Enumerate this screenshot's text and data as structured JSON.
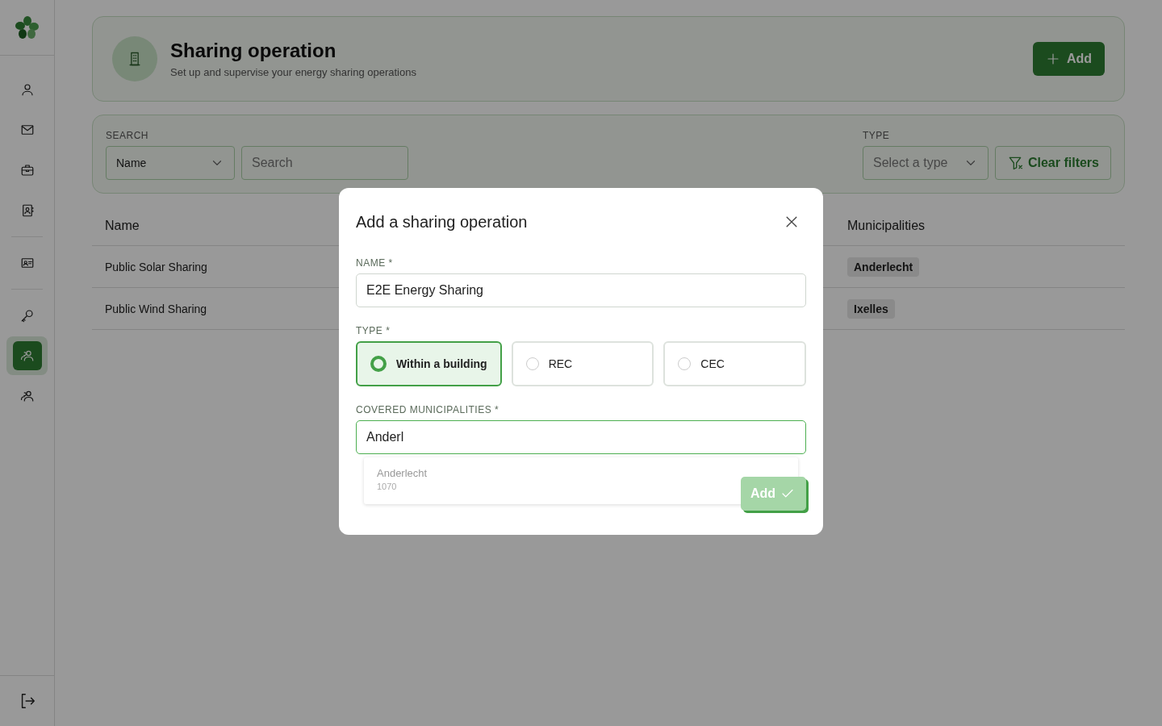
{
  "sidebar": {
    "groups": [
      {
        "items": [
          {
            "selected": false
          },
          {
            "selected": false
          },
          {
            "selected": false
          },
          {
            "selected": false
          }
        ]
      },
      {
        "items": [
          {
            "selected": false
          }
        ]
      },
      {
        "items": [
          {
            "selected": false
          },
          {
            "selected": true
          },
          {
            "selected": false
          }
        ]
      }
    ]
  },
  "header": {
    "title": "Sharing operation",
    "subtitle": "Set up and supervise your energy sharing operations",
    "add_button": "Add"
  },
  "filters": {
    "search_label": "SEARCH",
    "field_select": "Name",
    "search_placeholder": "Search",
    "type_label": "TYPE",
    "type_placeholder": "Select a type",
    "clear_button": "Clear filters"
  },
  "table": {
    "columns": [
      "Name",
      "Municipalities"
    ],
    "rows": [
      {
        "name": "Public Solar Sharing",
        "municipalities": [
          "Anderlecht"
        ]
      },
      {
        "name": "Public Wind Sharing",
        "municipalities": [
          "Ixelles"
        ]
      }
    ]
  },
  "modal": {
    "title": "Add a sharing operation",
    "name_label": "NAME *",
    "name_value": "E2E Energy Sharing",
    "type_label": "TYPE *",
    "types": [
      {
        "label": "Within a building",
        "selected": true
      },
      {
        "label": "REC",
        "selected": false
      },
      {
        "label": "CEC",
        "selected": false
      }
    ],
    "municipalities_label": "COVERED MUNICIPALITIES *",
    "municipalities_value": "Anderl",
    "suggestions": [
      {
        "name": "Anderlecht",
        "postcode": "1070"
      }
    ],
    "add_button": "Add"
  }
}
